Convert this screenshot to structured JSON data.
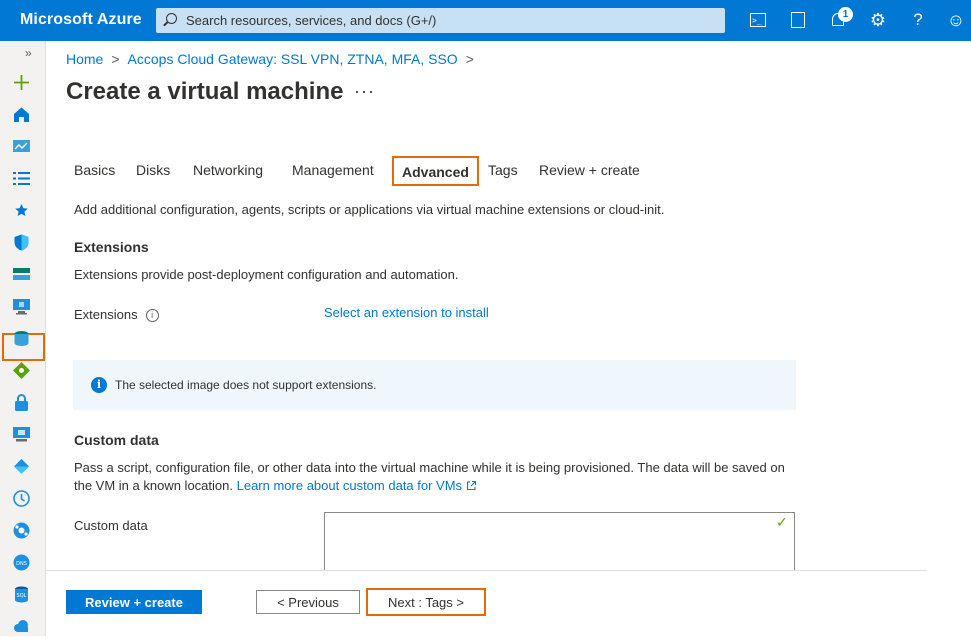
{
  "topbar": {
    "brand": "Microsoft Azure",
    "search_placeholder": "Search resources, services, and docs (G+/)",
    "notification_count": "1",
    "icons": [
      "cloud-shell-icon",
      "directory-filter-icon",
      "notifications-icon",
      "settings-icon",
      "help-icon",
      "feedback-icon"
    ]
  },
  "leftnav": {
    "collapse_glyph": "»",
    "icons": [
      "create-resource-icon",
      "home-icon",
      "dashboard-icon",
      "all-services-icon",
      "favorites-icon",
      "security-icon",
      "storage-icon",
      "virtual-machines-icon",
      "sql-icon",
      "network-icon",
      "key-vault-icon",
      "monitor-icon",
      "app-service-icon",
      "clock-icon",
      "kubernetes-icon",
      "dns-icon",
      "sql-db-icon",
      "cloud-icon"
    ]
  },
  "breadcrumb": {
    "home": "Home",
    "parent": "Accops Cloud Gateway: SSL VPN, ZTNA, MFA, SSO",
    "separator": ">"
  },
  "page": {
    "title": "Create a virtual machine",
    "more": "···"
  },
  "tabs": [
    {
      "label": "Basics"
    },
    {
      "label": "Disks"
    },
    {
      "label": "Networking"
    },
    {
      "label": "Management"
    },
    {
      "label": "Advanced"
    },
    {
      "label": "Tags"
    },
    {
      "label": "Review + create"
    }
  ],
  "content": {
    "intro": "Add additional configuration, agents, scripts or applications via virtual machine extensions or cloud-init.",
    "extensions_heading": "Extensions",
    "extensions_desc": "Extensions provide post-deployment configuration and automation.",
    "extensions_label": "Extensions",
    "extensions_link": "Select an extension to install",
    "info_message": "The selected image does not support extensions.",
    "custom_heading": "Custom data",
    "custom_desc_1": "Pass a script, configuration file, or other data into the virtual machine while it is being provisioned. The data will be saved on",
    "custom_desc_2": "the VM in a known location.",
    "custom_link": "Learn more about custom data for VMs",
    "custom_label": "Custom data",
    "custom_value": ""
  },
  "footer": {
    "review_create": "Review + create",
    "previous": "< Previous",
    "next": "Next : Tags >"
  },
  "colors": {
    "azure_blue": "#0078d4",
    "highlight_orange": "#e36c0a",
    "info_bg": "#eff6fc"
  }
}
